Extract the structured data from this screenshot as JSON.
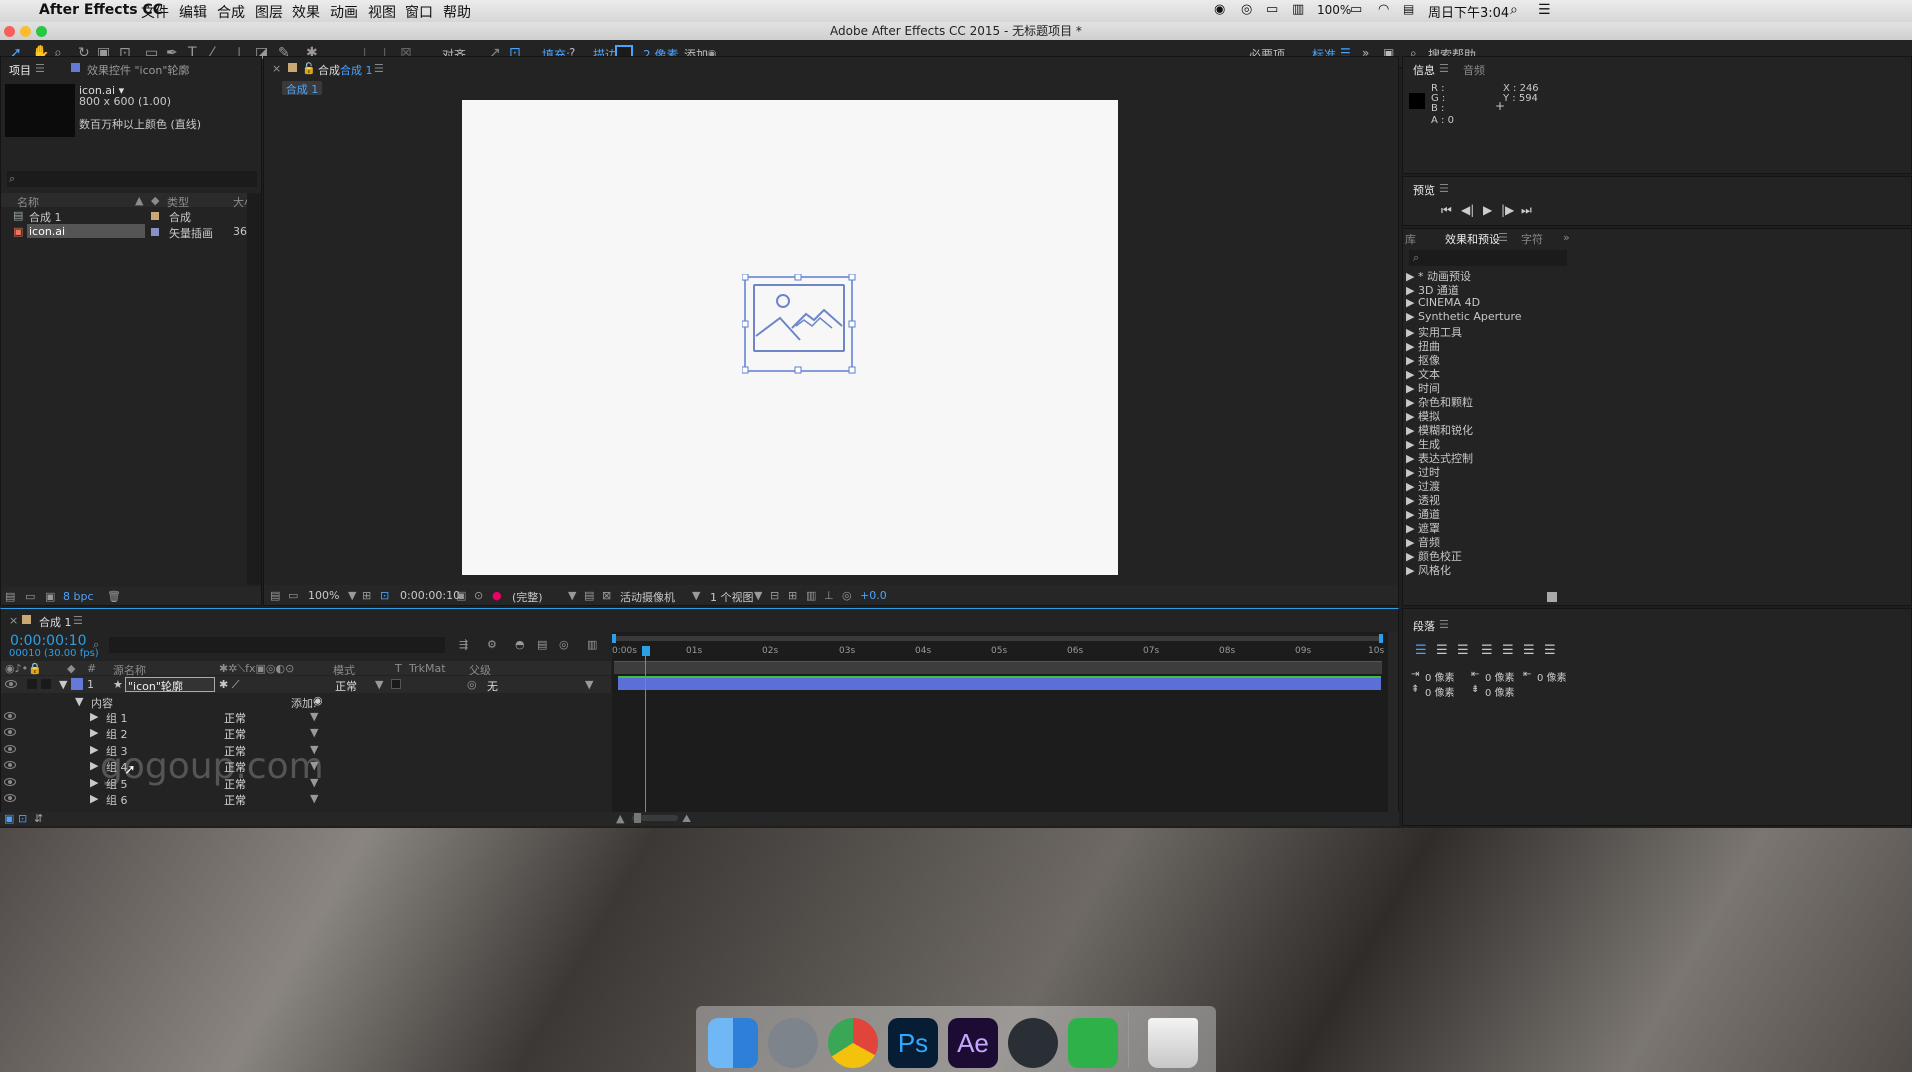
{
  "menubar": {
    "app_name": "After Effects CC",
    "menus": [
      "文件",
      "编辑",
      "合成",
      "图层",
      "效果",
      "动画",
      "视图",
      "窗口",
      "帮助"
    ],
    "battery": "100%",
    "clock": "周日下午3:04"
  },
  "window_title": "Adobe After Effects CC 2015 - 无标题项目 *",
  "toolbar": {
    "align_label": "对齐",
    "fill_label": "填充:",
    "fill_value": "?",
    "stroke_label": "描边:",
    "stroke_width": "2 像素",
    "add_label": "添加:",
    "workspace_essentials": "必要项",
    "workspace_standard": "标准",
    "search_help": "搜索帮助"
  },
  "project_panel": {
    "tab_project": "项目",
    "tab_effect_controls": "效果控件 \"icon\"轮廓",
    "item_name": "icon.ai ▾",
    "item_size": "800 x 600 (1.00)",
    "item_color": "数百万种以上颜色 (直线)",
    "columns": {
      "name": "名称",
      "type": "类型",
      "size": "大小"
    },
    "rows": [
      {
        "name": "合成 1",
        "type": "合成",
        "size": ""
      },
      {
        "name": "icon.ai",
        "type": "矢量插画",
        "size": "36!"
      }
    ],
    "bpc": "8 bpc"
  },
  "comp_panel": {
    "tab_label": "合成",
    "tab_name": "合成 1",
    "sub_tab": "合成 1",
    "zoom": "100%",
    "timecode": "0:00:00:10",
    "resolution": "(完整)",
    "camera": "活动摄像机",
    "views": "1 个视图",
    "exposure": "+0.0"
  },
  "info_panel": {
    "tab_info": "信息",
    "tab_audio": "音频",
    "r": "R :",
    "g": "G :",
    "b": "B :",
    "a": "A : 0",
    "x": "X : 246",
    "y": "Y : 594"
  },
  "preview_panel": {
    "title": "预览"
  },
  "effects_panel": {
    "tab_library": "库",
    "tab_effects": "效果和预设",
    "tab_character": "字符",
    "items": [
      "▶ * 动画预设",
      "▶ 3D 通道",
      "▶ CINEMA 4D",
      "▶ Synthetic Aperture",
      "▶ 实用工具",
      "▶ 扭曲",
      "▶ 抠像",
      "▶ 文本",
      "▶ 时间",
      "▶ 杂色和颗粒",
      "▶ 模拟",
      "▶ 模糊和锐化",
      "▶ 生成",
      "▶ 表达式控制",
      "▶ 过时",
      "▶ 过渡",
      "▶ 透视",
      "▶ 通道",
      "▶ 遮罩",
      "▶ 音频",
      "▶ 颜色校正",
      "▶ 风格化"
    ]
  },
  "paragraph_panel": {
    "title": "段落",
    "indent_left": "0 像素",
    "indent_first": "0 像素",
    "indent_right": "0 像素",
    "space_before": "0 像素",
    "space_after": "0 像素"
  },
  "timeline": {
    "tab_name": "合成 1",
    "timecode": "0:00:00:10",
    "frames": "00010 (30.00 fps)",
    "columns": {
      "num": "#",
      "source": "源名称",
      "mode": "模式",
      "t": "T",
      "trkmat": "TrkMat",
      "parent": "父级"
    },
    "layer": {
      "num": "1",
      "name": "\"icon\"轮廓",
      "mode": "正常",
      "parent": "无"
    },
    "contents_label": "内容",
    "add_label": "添加:",
    "groups": [
      {
        "name": "组 1",
        "mode": "正常"
      },
      {
        "name": "组 2",
        "mode": "正常"
      },
      {
        "name": "组 3",
        "mode": "正常"
      },
      {
        "name": "组 4",
        "mode": "正常"
      },
      {
        "name": "组 5",
        "mode": "正常"
      },
      {
        "name": "组 6",
        "mode": "正常"
      }
    ],
    "ruler": [
      "0:00s",
      "01s",
      "02s",
      "03s",
      "04s",
      "05s",
      "06s",
      "07s",
      "08s",
      "09s",
      "10s"
    ]
  },
  "watermark": "gogoup.com",
  "colors": {
    "accent": "#2d9fe6",
    "layer_bar": "#5b6fd6",
    "selection_blue": "#5b7fd1"
  }
}
